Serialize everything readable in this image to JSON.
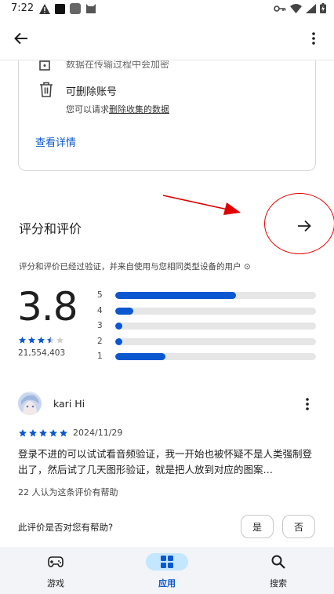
{
  "status_bar": {
    "time": "7:22"
  },
  "safety": {
    "partial_text": "数据在传输过程中会加密",
    "delete_title": "可删除账号",
    "delete_sub_prefix": "您可以请求",
    "delete_sub_link": "删除收集的数据",
    "see_details": "查看详情"
  },
  "ratings": {
    "title": "评分和评价",
    "verify_note": "评分和评价已经过验证，并来自使用与您相同类型设备的用户 ⊙",
    "score": "3.8",
    "count": "21,554,403",
    "stars_value": 3.5,
    "distribution": [
      {
        "label": "5",
        "fraction": 0.6
      },
      {
        "label": "4",
        "fraction": 0.09
      },
      {
        "label": "3",
        "fraction": 0.035
      },
      {
        "label": "2",
        "fraction": 0.035
      },
      {
        "label": "1",
        "fraction": 0.25
      }
    ]
  },
  "review": {
    "name": "kari Hi",
    "date": "2024/11/29",
    "stars": 5,
    "text": "登录不进的可以试试看音频验证，我一开始也被怀疑不是人类强制登出了，然后试了几天图形验证，就是把人放到对应的图案…",
    "helpful_count": "22 人认为这条评价有帮助",
    "helpful_question": "此评价是否对您有帮助?",
    "yes_label": "是",
    "no_label": "否"
  },
  "nav": {
    "games": "游戏",
    "apps": "应用",
    "search": "搜索"
  },
  "colors": {
    "accent": "#0b57d0",
    "annotation": "#e00000",
    "nav_active_bg": "#c2e7ff"
  }
}
